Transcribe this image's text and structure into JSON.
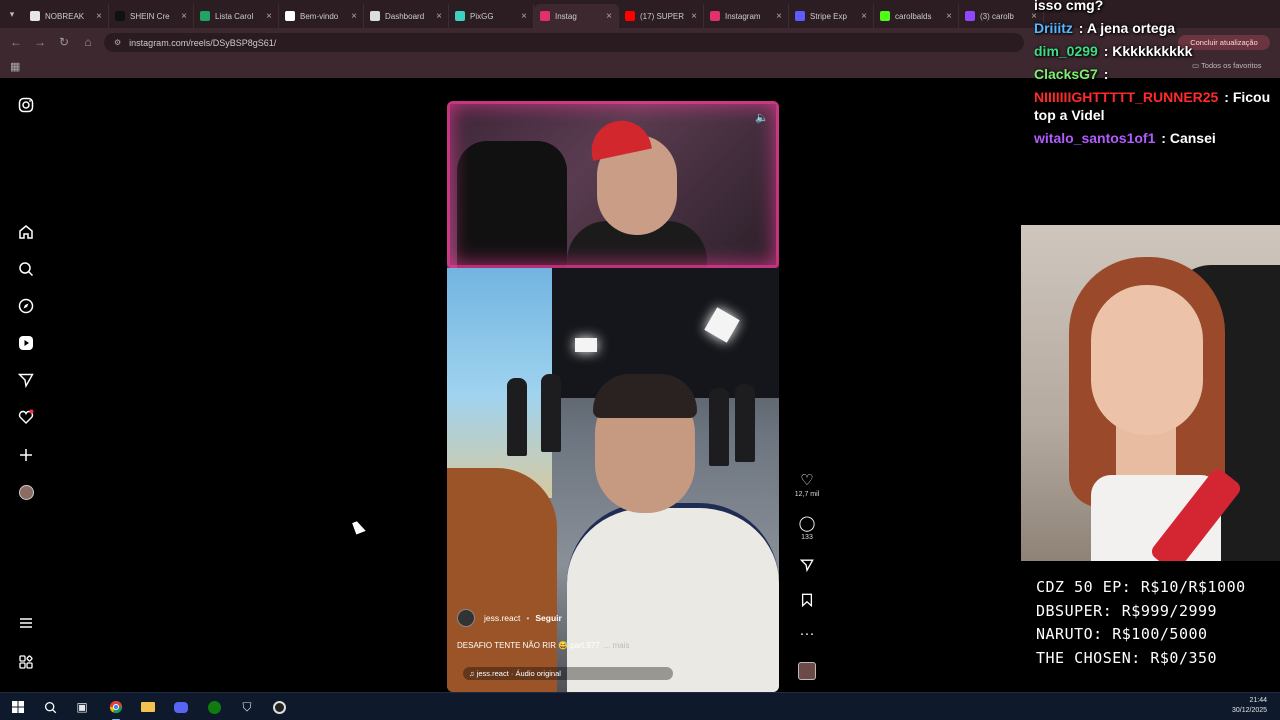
{
  "browser": {
    "tabs": [
      {
        "label": "NOBREAK",
        "color": "#e6e6e6",
        "active": false
      },
      {
        "label": "SHEIN Cre",
        "color": "#111111",
        "active": false
      },
      {
        "label": "Lista Carol",
        "color": "#1fa463",
        "active": false
      },
      {
        "label": "Bem-vindo",
        "color": "#ffffff",
        "active": false
      },
      {
        "label": "Dashboard",
        "color": "#dddddd",
        "active": false
      },
      {
        "label": "PixGG",
        "color": "#3fd0c4",
        "active": false
      },
      {
        "label": "Instag",
        "color": "#e1306c",
        "active": true
      },
      {
        "label": "(17) SUPER",
        "color": "#ff0000",
        "active": false
      },
      {
        "label": "Instagram",
        "color": "#e1306c",
        "active": false
      },
      {
        "label": "Stripe Exp",
        "color": "#635bff",
        "active": false
      },
      {
        "label": "carolbalds",
        "color": "#53fc18",
        "active": false
      },
      {
        "label": "(3) carolb",
        "color": "#9146ff",
        "active": false
      }
    ],
    "url": "instagram.com/reels/DSyBSP8gS61/",
    "update_label": "Concluir atualização",
    "favorites_label": "Todos os favoritos"
  },
  "instagram": {
    "reel": {
      "author": "jess.react",
      "follow_label": "Seguir",
      "caption": "DESAFIO TENTE NÃO RIR 😅 part.977",
      "more_label": "... mais",
      "audio": "jess.react · Áudio original",
      "likes": "12,7 mil",
      "comments": "133"
    }
  },
  "chat": {
    "messages": [
      {
        "user": "Driiitz",
        "user_color": "#57b6ff",
        "text": "A jena ortega"
      },
      {
        "user": "dim_0299",
        "user_color": "#3ddc84",
        "text": "Kkkkkkkkkk"
      },
      {
        "user": "ClacksG7",
        "user_color": "#7cf06e",
        "text": ""
      },
      {
        "user": "NIIIIIIIGHTTTTT_RUNNER25",
        "user_color": "#ff2a2a",
        "text": "Ficou top a Videl"
      },
      {
        "user": "witalo_santos1of1",
        "user_color": "#b15cff",
        "text": "Cansei"
      }
    ],
    "top_partial": "isso cmg?"
  },
  "overlay_prices": [
    "CDZ 50 EP: R$10/R$1000",
    "DBSUPER: R$999/2999",
    "NARUTO: R$100/5000",
    "THE CHOSEN: R$0/350"
  ],
  "taskbar": {
    "time": "21:44",
    "date": "30/12/2025"
  }
}
